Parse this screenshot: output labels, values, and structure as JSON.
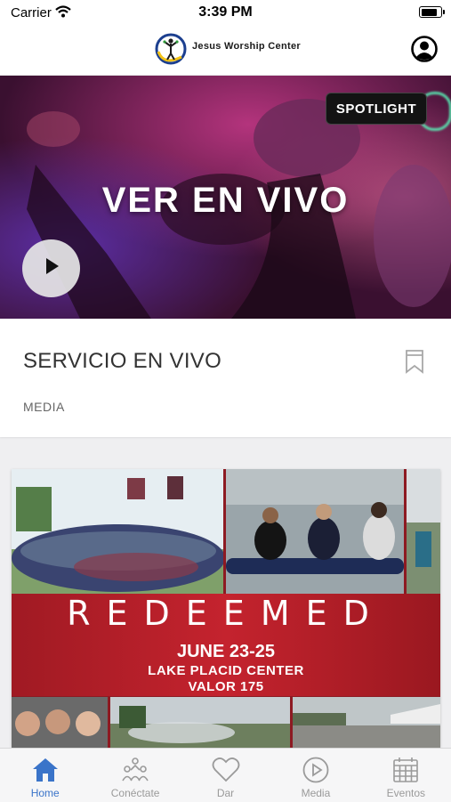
{
  "status_bar": {
    "carrier": "Carrier",
    "time": "3:39 PM",
    "battery_level": 0.9
  },
  "header": {
    "logo_text": "Jesus Worship Center",
    "logo_icon": "church-logo-icon",
    "profile_icon": "profile-icon"
  },
  "hero": {
    "title": "VER EN VIVO",
    "spotlight_label": "SPOTLIGHT",
    "play_icon": "play-icon"
  },
  "card": {
    "title": "SERVICIO EN VIVO",
    "category": "MEDIA",
    "bookmark_icon": "bookmark-icon"
  },
  "promo": {
    "title": "REDEEMED",
    "dates": "JUNE 23-25",
    "location": "LAKE PLACID CENTER",
    "address": "VALOR 175"
  },
  "tabs": [
    {
      "label": "Home",
      "icon": "home-icon",
      "active": true
    },
    {
      "label": "Conéctate",
      "icon": "people-icon",
      "active": false
    },
    {
      "label": "Dar",
      "icon": "heart-icon",
      "active": false
    },
    {
      "label": "Media",
      "icon": "play-circle-icon",
      "active": false
    },
    {
      "label": "Eventos",
      "icon": "calendar-icon",
      "active": false
    }
  ],
  "colors": {
    "accent": "#3a74c9",
    "tab_inactive": "#9a9a9a",
    "promo_red": "#c4232e"
  }
}
